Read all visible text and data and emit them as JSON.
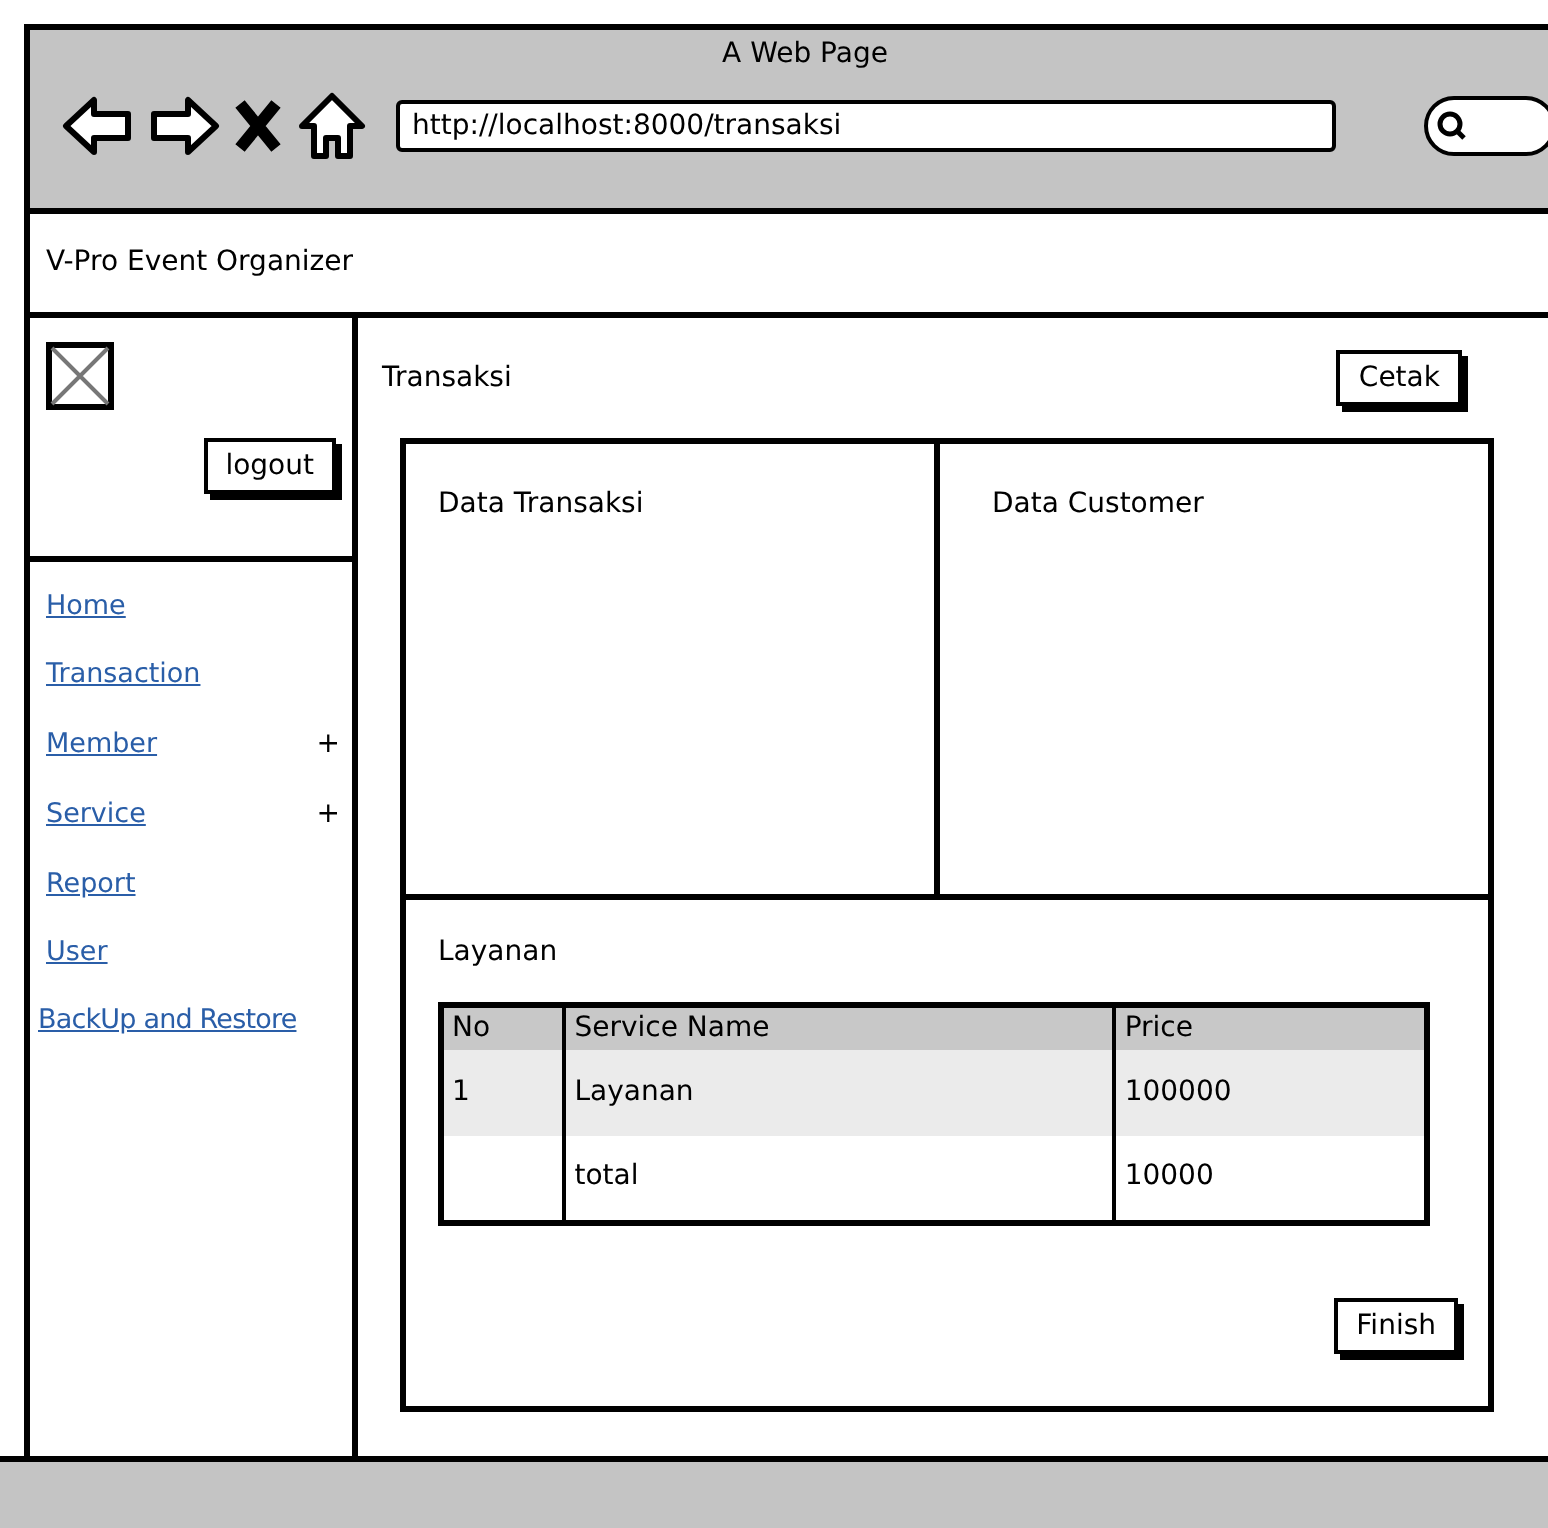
{
  "window": {
    "title": "A Web Page",
    "url": "http://localhost:8000/transaksi"
  },
  "header": {
    "title": "V-Pro Event Organizer"
  },
  "sidebar": {
    "logout": "logout",
    "items": [
      {
        "label": "Home"
      },
      {
        "label": "Transaction"
      },
      {
        "label": "Member",
        "toggle": "+"
      },
      {
        "label": "Service",
        "toggle": "+"
      },
      {
        "label": "Report"
      },
      {
        "label": "User"
      },
      {
        "label": "BackUp and Restore"
      }
    ]
  },
  "main": {
    "title": "Transaksi",
    "print_button": "Cetak",
    "panels": [
      "Data Transaksi",
      "Data Customer"
    ],
    "services": {
      "title": "Layanan",
      "columns": [
        "No",
        "Service Name",
        "Price"
      ],
      "rows": [
        [
          "1",
          "Layanan",
          "100000"
        ],
        [
          "",
          "total",
          "10000"
        ]
      ]
    },
    "finish_button": "Finish"
  }
}
